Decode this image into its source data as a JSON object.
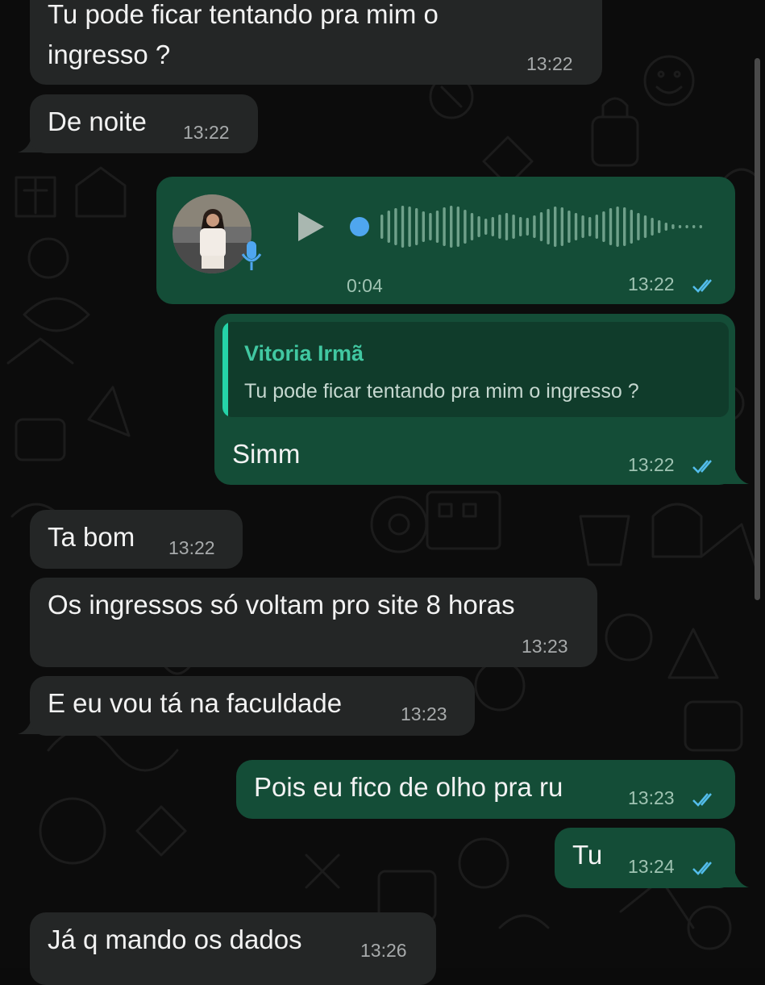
{
  "messages": [
    {
      "text_line1": "Tu pode ficar tentando pra mim o",
      "text_line2": "ingresso ?",
      "time": "13:22"
    },
    {
      "text": "De noite",
      "time": "13:22"
    },
    {
      "voice_duration": "0:04",
      "time": "13:22",
      "status": "read"
    },
    {
      "quote_author": "Vitoria Irmã",
      "quote_text": "Tu pode ficar tentando pra mim o ingresso ?",
      "text": "Simm",
      "time": "13:22",
      "status": "read"
    },
    {
      "text": "Ta bom",
      "time": "13:22"
    },
    {
      "text": "Os ingressos só voltam pro site 8 horas",
      "time": "13:23"
    },
    {
      "text": "E eu vou tá na faculdade",
      "time": "13:23"
    },
    {
      "text": "Pois eu fico de olho pra ru",
      "time": "13:23",
      "status": "read"
    },
    {
      "text": "Tu",
      "time": "13:24",
      "status": "read"
    },
    {
      "text": "Já q mando os dados",
      "time": "13:26"
    }
  ],
  "colors": {
    "incoming_bubble": "#242626",
    "outgoing_bubble": "#144d37",
    "read_ticks": "#53bdeb",
    "quote_author": "#41c8a2",
    "voice_dot": "#4fa6ef"
  },
  "icons": {
    "play": "play-icon",
    "mic": "microphone-icon",
    "read_status": "double-check-icon"
  }
}
